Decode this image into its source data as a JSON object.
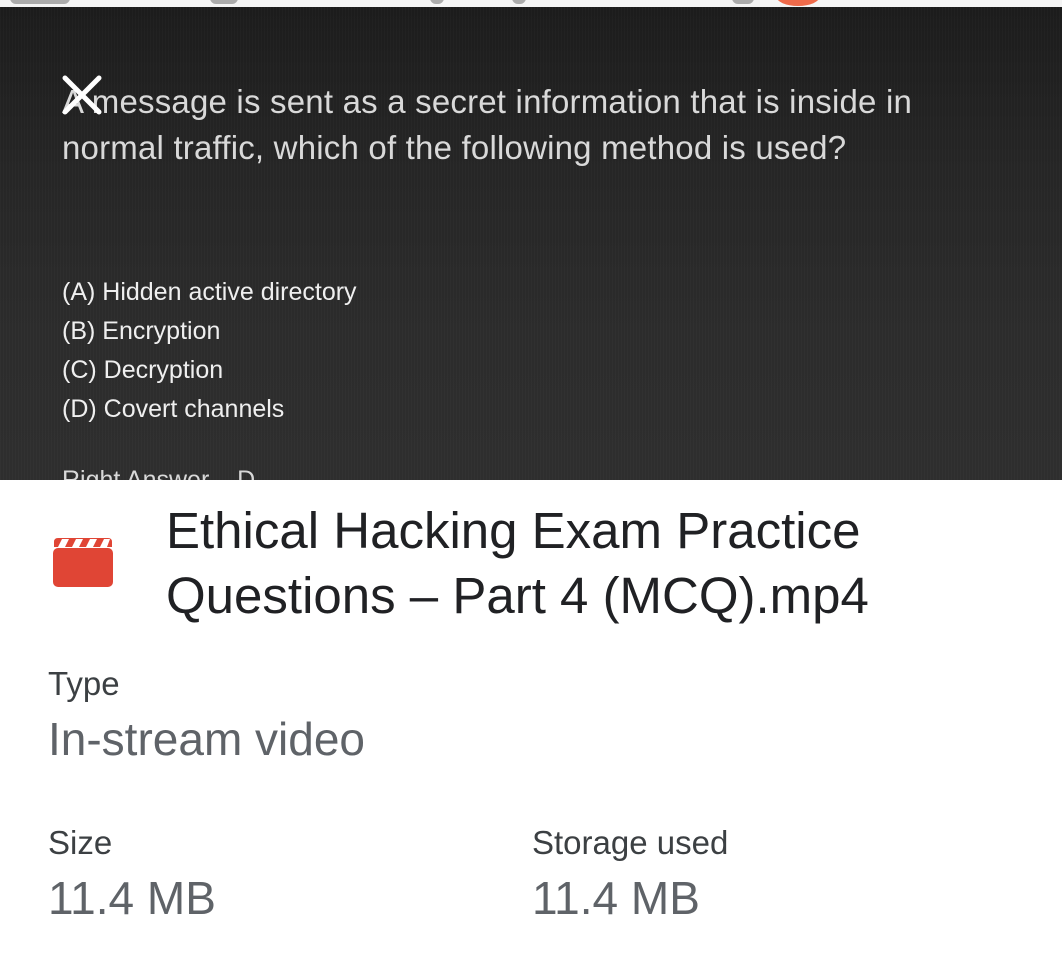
{
  "preview": {
    "question": "A message is sent as a secret information that is inside in normal traffic, which of the following method is used?",
    "options": [
      "(A) Hidden active directory",
      "(B) Encryption",
      "(C) Decryption",
      "(D) Covert channels"
    ],
    "answer_partial": "Right Answer – D"
  },
  "details": {
    "file_icon": "video-file-icon",
    "file_name": "Ethical Hacking Exam Practice Questions – Part 4 (MCQ).mp4",
    "type_label": "Type",
    "type_value": "In-stream video",
    "size_label": "Size",
    "size_value": "11.4 MB",
    "storage_label": "Storage used",
    "storage_value": "11.4 MB"
  },
  "colors": {
    "icon_red": "#e04535",
    "preview_bg": "#262626"
  }
}
